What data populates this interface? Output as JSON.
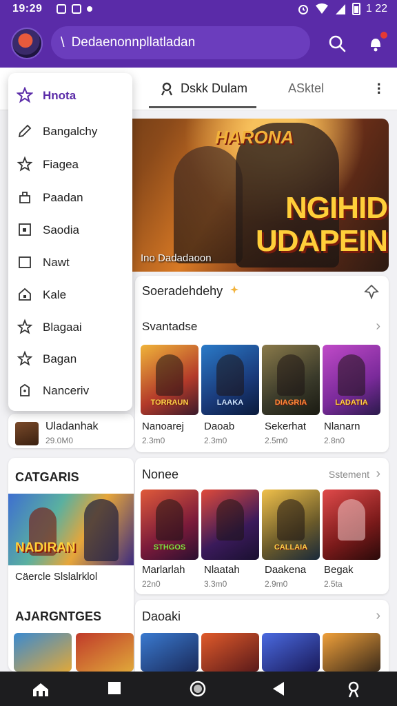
{
  "status_bar": {
    "time": "19:29",
    "battery": "1 22"
  },
  "app_bar": {
    "search_text": "Dedaenonnpllatladan"
  },
  "tabs": {
    "active_label": "Dskk Dulam",
    "second_label": "ASktel"
  },
  "drawer": {
    "items": [
      {
        "label": "Hnota",
        "icon": "star-icon"
      },
      {
        "label": "Bangalchy",
        "icon": "pencil-icon"
      },
      {
        "label": "Fiagea",
        "icon": "star-outline-icon"
      },
      {
        "label": "Paadan",
        "icon": "bag-icon"
      },
      {
        "label": "Saodia",
        "icon": "square-dot-icon"
      },
      {
        "label": "Nawt",
        "icon": "square-icon"
      },
      {
        "label": "Kale",
        "icon": "home-icon"
      },
      {
        "label": "Blagaai",
        "icon": "star-outline-icon"
      },
      {
        "label": "Bagan",
        "icon": "star-outline-icon"
      },
      {
        "label": "Nanceriv",
        "icon": "clock-icon"
      }
    ]
  },
  "hero": {
    "title_top": "HARONA",
    "title_line1": "NGIHID",
    "title_line2": "UDAPEIN",
    "caption": "Ino Dadadaoon"
  },
  "section1": {
    "header": "Soeradehdehy",
    "subheader": "Svantadse",
    "games": [
      {
        "name": "Nanoarej",
        "size": "2.3m0",
        "tile_text": "TORRAUN"
      },
      {
        "name": "Daoab",
        "size": "2.3m0",
        "tile_text": "LAAKA"
      },
      {
        "name": "Sekerhat",
        "size": "2.5m0",
        "tile_text": "DIAGRIA"
      },
      {
        "name": "Nlanarn",
        "size": "2.8n0",
        "tile_text": "LADATIA"
      }
    ]
  },
  "left_col": {
    "user_name": "Uladanhak",
    "user_meta": "29.0M0",
    "category_header": "CATGARIS",
    "category_banner_text": "NADIRAN",
    "category_caption": "Cäercle Slslalrklol",
    "section_header": "AJARGNTGES"
  },
  "section2": {
    "header": "Nonee",
    "action": "Sstement",
    "games": [
      {
        "name": "Marlarlah",
        "size": "22n0",
        "tile_text": "STHGOS"
      },
      {
        "name": "Nlaatah",
        "size": "3.3m0",
        "tile_text": ""
      },
      {
        "name": "Daakena",
        "size": "2.9m0",
        "tile_text": "CALLAIA"
      },
      {
        "name": "Begak",
        "size": "2.5ta",
        "tile_text": ""
      }
    ]
  },
  "section3": {
    "header": "Daoaki"
  },
  "colors": {
    "primary": "#5a2ba8",
    "accent": "#f2b23a",
    "background": "#f1f1f4"
  }
}
